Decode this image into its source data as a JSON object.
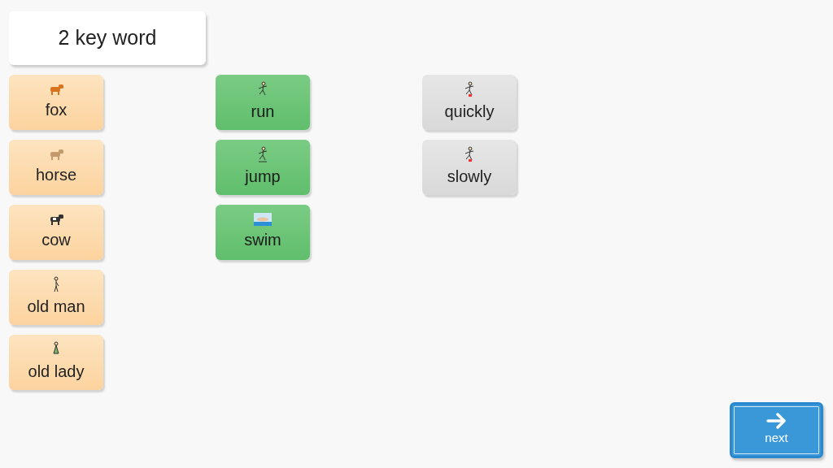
{
  "title": "2 key word",
  "columns": [
    {
      "kind": "noun",
      "words": [
        "fox",
        "horse",
        "cow",
        "old man",
        "old lady"
      ]
    },
    {
      "kind": "verb",
      "words": [
        "run",
        "jump",
        "swim"
      ]
    },
    {
      "kind": "adverb",
      "words": [
        "quickly",
        "slowly"
      ]
    }
  ],
  "next_button": {
    "label": "next"
  }
}
